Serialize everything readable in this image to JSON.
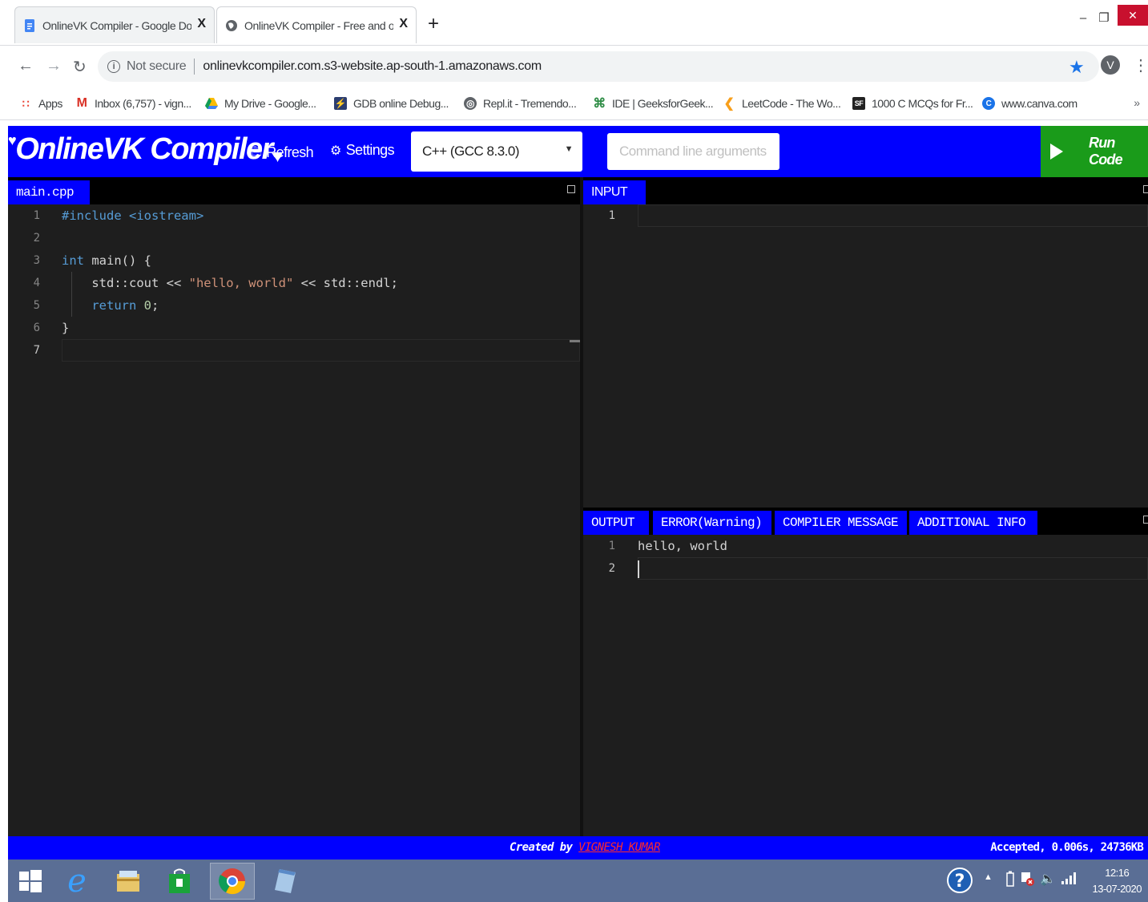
{
  "browser": {
    "tabs": [
      {
        "title": "OnlineVK Compiler - Google Doc",
        "favicon": "google-docs-icon",
        "active": false
      },
      {
        "title": "OnlineVK Compiler - Free and op",
        "favicon": "globe-icon",
        "active": true
      }
    ],
    "new_tab_label": "+",
    "close_label": "X",
    "address": {
      "security_label": "Not secure",
      "url": "onlinevkcompiler.com.s3-website.ap-south-1.amazonaws.com"
    },
    "profile_initial": "V",
    "bookmarks": [
      {
        "label": "Apps",
        "icon": "apps-grid-icon"
      },
      {
        "label": "Inbox (6,757) - vign...",
        "icon": "gmail-icon"
      },
      {
        "label": "My Drive - Google...",
        "icon": "google-drive-icon"
      },
      {
        "label": "GDB online Debug...",
        "icon": "gdb-icon"
      },
      {
        "label": "Repl.it - Tremendo...",
        "icon": "replit-icon"
      },
      {
        "label": "IDE | GeeksforGeek...",
        "icon": "geeksforgeeks-icon"
      },
      {
        "label": "LeetCode - The Wo...",
        "icon": "leetcode-icon"
      },
      {
        "label": "1000 C MCQs for Fr...",
        "icon": "sanfoundry-icon"
      },
      {
        "label": "www.canva.com",
        "icon": "canva-icon"
      }
    ],
    "bookmarks_more": "»"
  },
  "app": {
    "logo": "OnlineVK Compiler",
    "refresh_label": "Refresh",
    "settings_label": "Settings",
    "language": "C++ (GCC 8.3.0)",
    "cmd_placeholder": "Command line arguments",
    "run_label": "Run Code",
    "accent": "#0000ff",
    "run_color": "#1a9b1a"
  },
  "editor": {
    "filename": "main.cpp",
    "line_numbers": [
      "1",
      "2",
      "3",
      "4",
      "5",
      "6",
      "7"
    ],
    "lines": {
      "l1": "#include <iostream>",
      "l3_kw": "int",
      "l3_rest": " main() {",
      "l4_a": "    std::cout << ",
      "l4_str": "\"hello, world\"",
      "l4_b": " << std::endl;",
      "l5_kw": "    return",
      "l5_sp": " ",
      "l5_num": "0",
      "l5_end": ";",
      "l6": "}"
    }
  },
  "input_pane": {
    "tab_label": "INPUT",
    "line_numbers": [
      "1"
    ]
  },
  "output_pane": {
    "tabs": [
      "OUTPUT",
      "ERROR(Warning)",
      "COMPILER MESSAGE",
      "ADDITIONAL INFO"
    ],
    "line_numbers": [
      "1",
      "2"
    ],
    "lines": [
      "hello, world",
      ""
    ]
  },
  "status": {
    "credit_prefix": "Created by ",
    "author": "VIGNESH KUMAR",
    "verdict": "Accepted, 0.006s, 24736KB"
  },
  "taskbar": {
    "time": "12:16",
    "date": "13-07-2020"
  }
}
